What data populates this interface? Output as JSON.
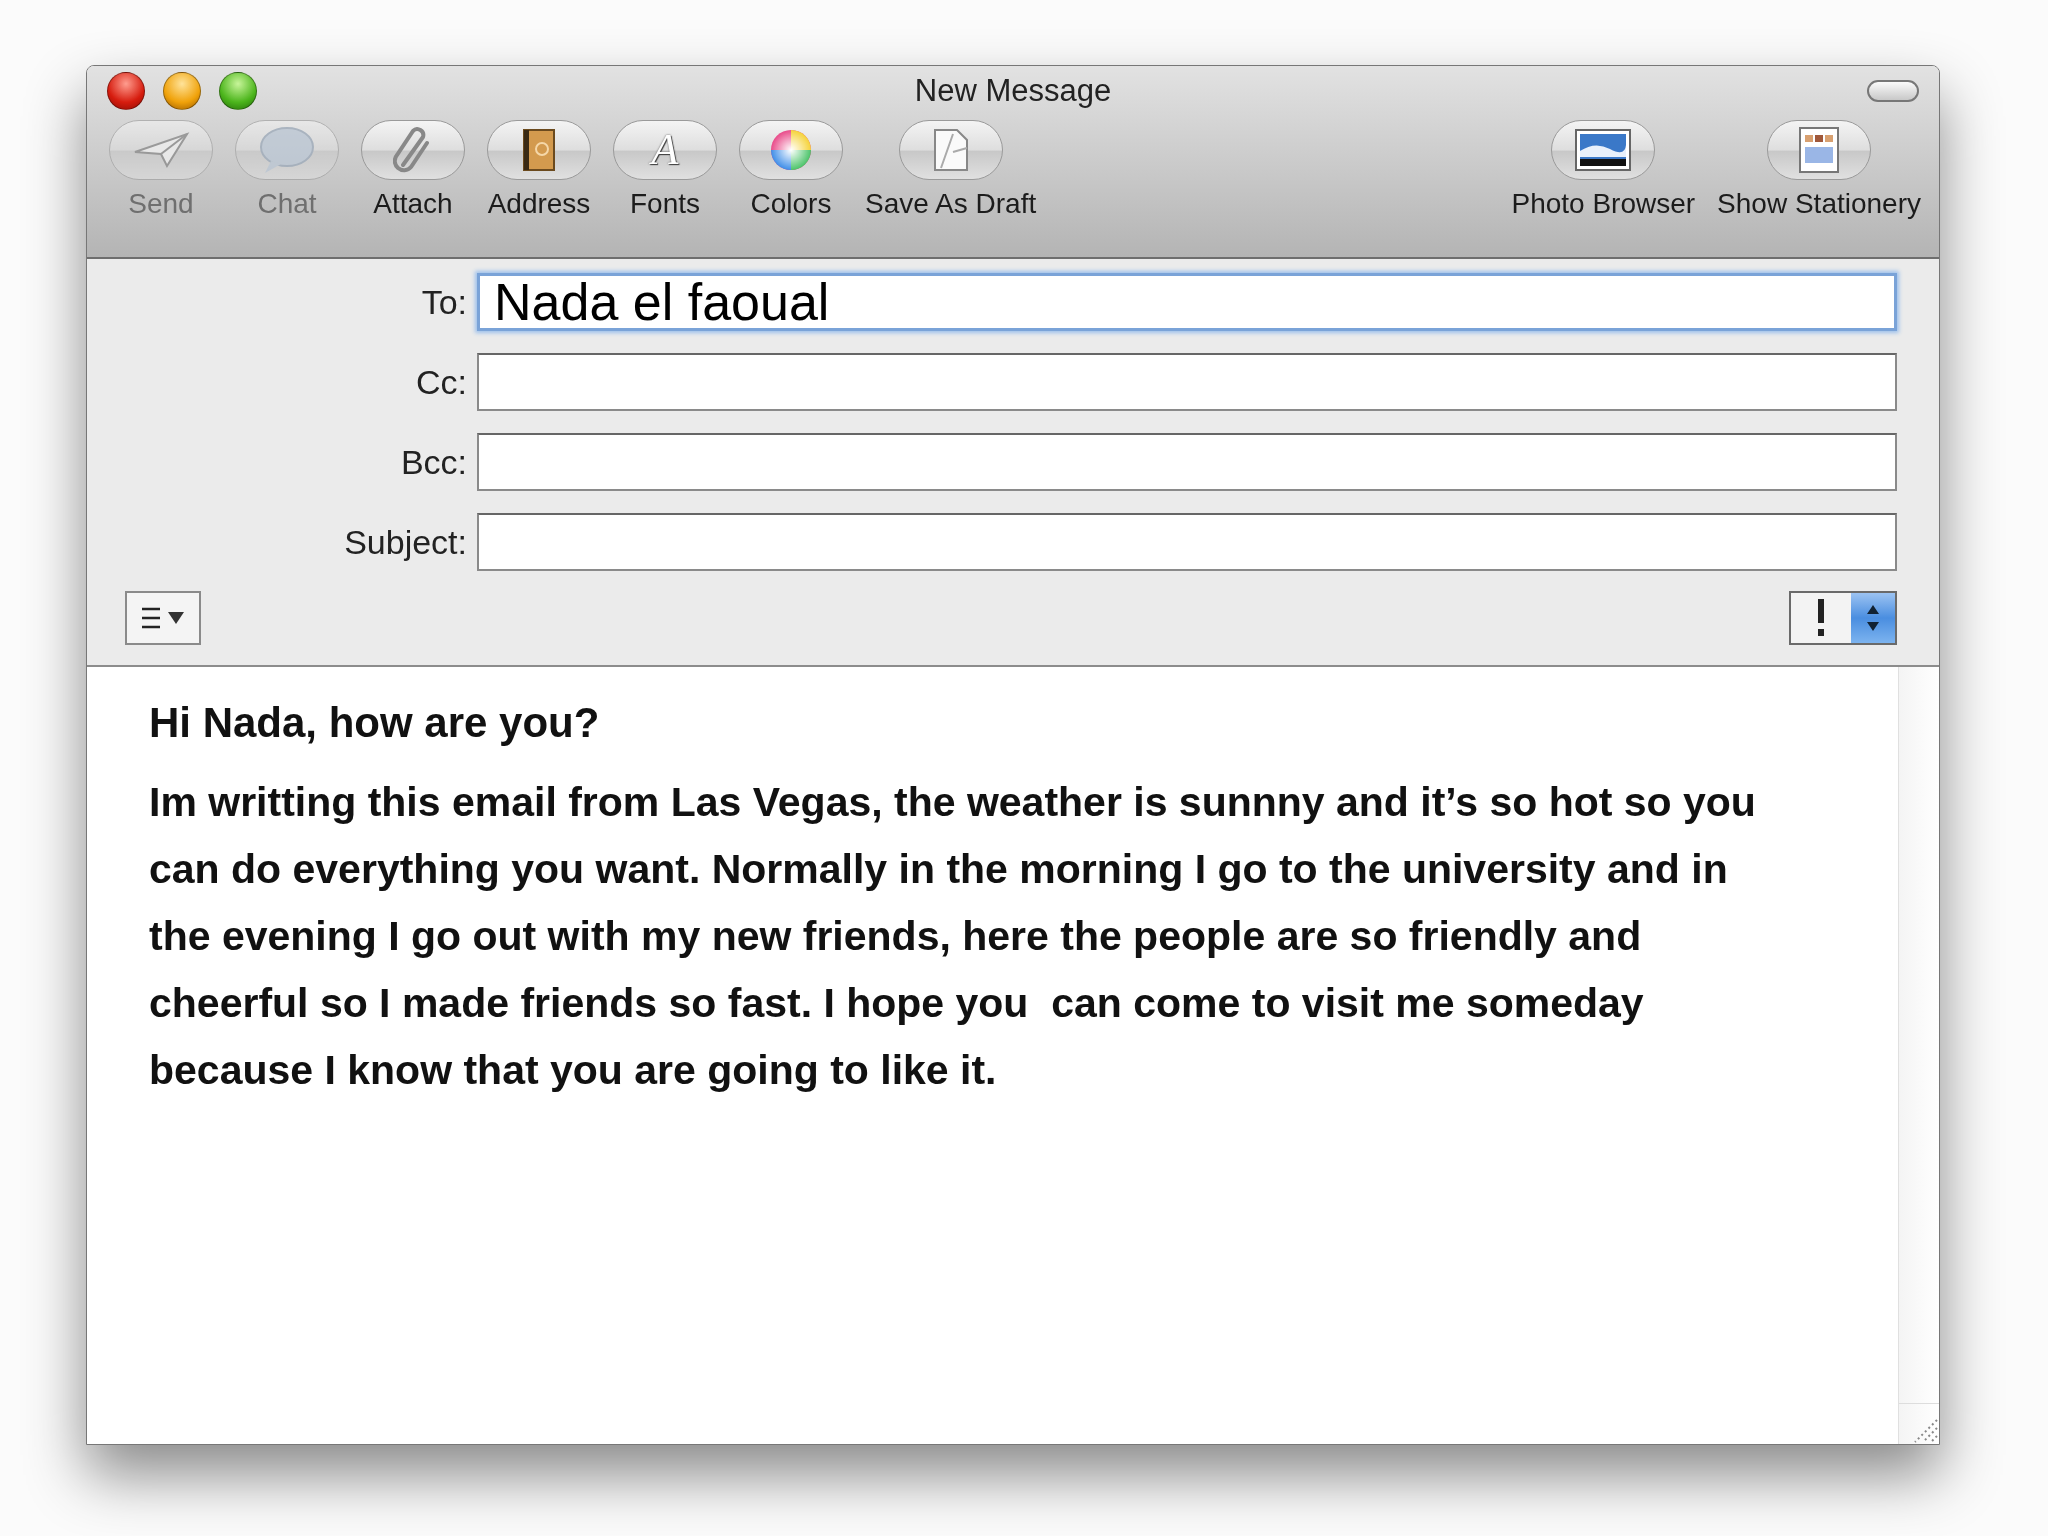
{
  "window": {
    "title": "New Message"
  },
  "toolbar": {
    "left_items": [
      {
        "kind": "send",
        "label": "Send",
        "disabled": true
      },
      {
        "kind": "chat",
        "label": "Chat",
        "disabled": true
      },
      {
        "kind": "attach",
        "label": "Attach",
        "disabled": false
      },
      {
        "kind": "address",
        "label": "Address",
        "disabled": false
      },
      {
        "kind": "fonts",
        "label": "Fonts",
        "glyph": "A",
        "disabled": false
      },
      {
        "kind": "colors",
        "label": "Colors",
        "disabled": false
      },
      {
        "kind": "draft",
        "label": "Save As Draft",
        "disabled": false
      }
    ],
    "right_items": [
      {
        "kind": "photo",
        "label": "Photo Browser",
        "disabled": false
      },
      {
        "kind": "stationery",
        "label": "Show Stationery",
        "disabled": false
      }
    ]
  },
  "header_fields": [
    {
      "label": "To:",
      "value": "Nada el faoual",
      "focused": true
    },
    {
      "label": "Cc:",
      "focused": false
    },
    {
      "label": "Bcc:",
      "focused": false
    },
    {
      "label": "Subject:",
      "focused": false
    }
  ],
  "body": {
    "greeting": "Hi Nada, how are you?",
    "paragraph": "Im writting this email from Las Vegas, the weather is sunnny and it’s so hot so you can do everything you want. Normally in the morning I go to the university and in the evening I go out with my new friends, here the people are so friendly and cheerful so I made friends so fast. I hope you  can come to visit me someday because I know that you are going to like it."
  }
}
